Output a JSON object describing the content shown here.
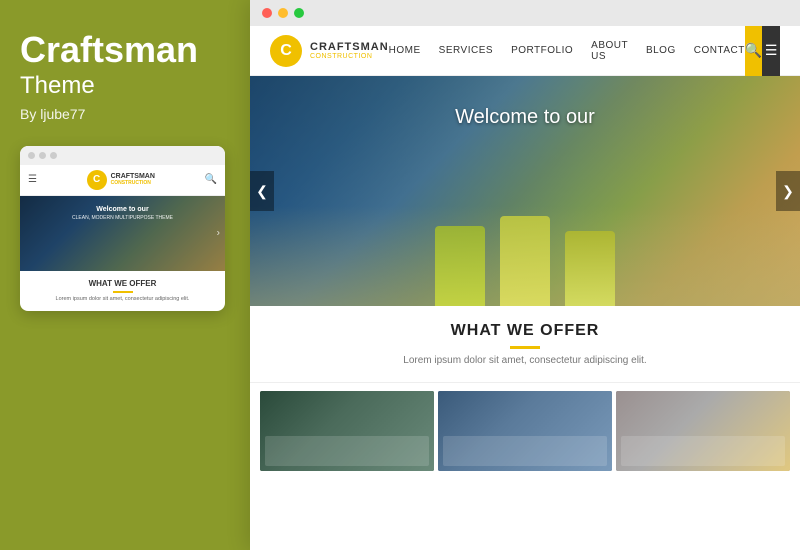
{
  "leftPanel": {
    "title": "Craftsman",
    "subtitle": "Theme",
    "author": "By ljube77"
  },
  "miniPreview": {
    "logoLetter": "C",
    "logoName": "CRAFTSMAN",
    "logoTagline": "CONSTRUCTION",
    "heroText": "Welcome to our",
    "heroSub": "CLEAN, MODERN MULTIPURPOSE THEME",
    "offerTitle": "WHAT WE OFFER",
    "offerText": "Lorem ipsum dolor sit amet, consectetur adipiscing elit."
  },
  "mainBrowser": {
    "dots": [
      "red",
      "yellow",
      "green"
    ],
    "navbar": {
      "logoLetter": "C",
      "logoName": "CRAFTSMAN",
      "logoTagline": "CONSTRUCTION",
      "navLinks": [
        "HOME",
        "SERVICES",
        "PORTFOLIO",
        "ABOUT US",
        "BLOG",
        "CONTACT"
      ],
      "searchIcon": "🔍",
      "menuIcon": "☰"
    },
    "hero": {
      "welcomeText": "Welcome to our",
      "arrowLeft": "❮",
      "arrowRight": "❯"
    },
    "offerSection": {
      "title": "WHAT WE OFFER",
      "description": "Lorem ipsum dolor sit amet, consectetur adipiscing elit."
    }
  },
  "colors": {
    "accent": "#f0c000",
    "dark": "#333333",
    "background": "#8a9a2a",
    "white": "#ffffff"
  }
}
